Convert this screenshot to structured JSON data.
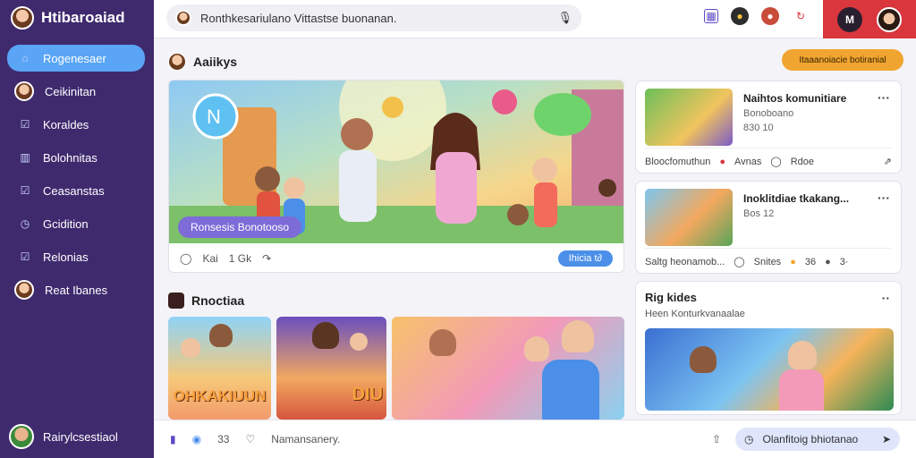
{
  "app": {
    "title": "Htibaroaiad"
  },
  "sidebar": {
    "items": [
      {
        "label": "Rogenesaer",
        "icon": "home-icon",
        "active": true
      },
      {
        "label": "Ceikinitan",
        "icon": "avatar"
      },
      {
        "label": "Koraldes",
        "icon": "check-icon"
      },
      {
        "label": "Bolohnitas",
        "icon": "chart-icon"
      },
      {
        "label": "Ceasanstas",
        "icon": "check-icon"
      },
      {
        "label": "Gcidition",
        "icon": "clock-icon"
      },
      {
        "label": "Relonias",
        "icon": "check-icon"
      },
      {
        "label": "Reat Ibanes",
        "icon": "avatar"
      }
    ],
    "bottom_user": "Rairylcsestiaol"
  },
  "search": {
    "text": "Ronthkesariulano Vittastse buonanan."
  },
  "top_red": {
    "label": "M"
  },
  "activity": {
    "title": "Aaiikys",
    "badge": "Itaaanoiacie botiranial"
  },
  "hero": {
    "tag": "Ronsesis Bonotooso",
    "comments": "Kai",
    "likes": "1 Gk",
    "pill": "Ihicia",
    "pill_icon": "t∂"
  },
  "moments": {
    "title": "Rnoctiaa",
    "thumb1_caption": "OHKAKIUUN",
    "thumb2_caption": "DIU"
  },
  "right": {
    "card1": {
      "title": "Naihtos komunitiare",
      "sub1": "Bonoboano",
      "sub2": "830 10",
      "foot_left": "Bloocfomuthun",
      "foot_mid": "Avnas",
      "foot_right": "Rdoe"
    },
    "card2": {
      "title": "Inoklitdiae tkakang...",
      "sub1": "Bos 12",
      "foot_left": "Saltg heonamob...",
      "foot_mid": "Snites",
      "foot_num": "36",
      "foot_right": "3·"
    },
    "card3": {
      "title": "Rig kides",
      "sub": "Heen Konturkvanaalae"
    }
  },
  "bottombar": {
    "count": "33",
    "placeholder": "Namansanery.",
    "pill": "Olanfitoig bhiotanao"
  },
  "colors": {
    "sidebar": "#3f2a6e",
    "active": "#5aa5f5",
    "accent_orange": "#f0a531",
    "red": "#d9363e"
  }
}
